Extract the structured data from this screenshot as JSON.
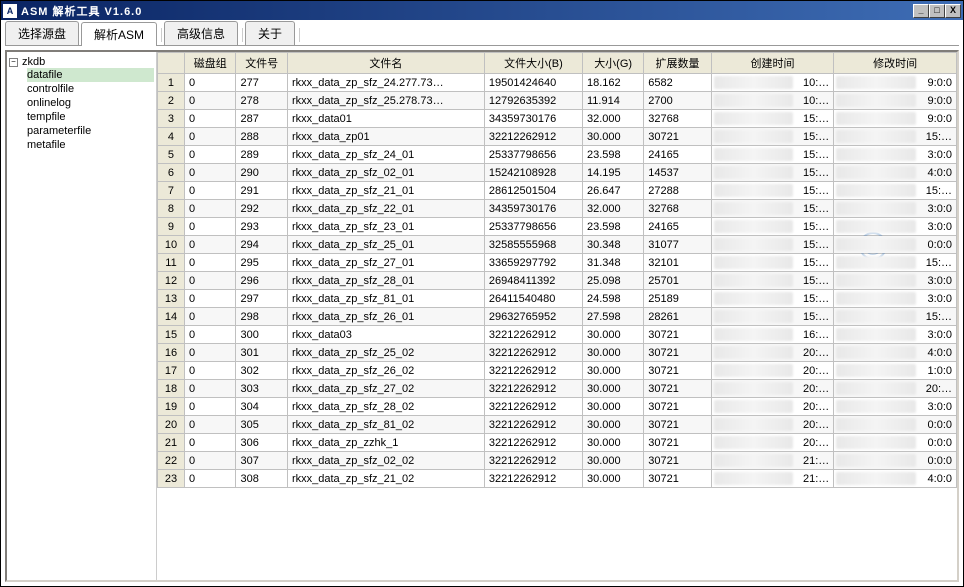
{
  "title": "ASM 解析工具  V1.6.0",
  "winbtns": {
    "min": "_",
    "max": "□",
    "close": "X"
  },
  "tabs": [
    "选择源盘",
    "解析ASM",
    "高级信息",
    "关于"
  ],
  "active_tab": 1,
  "tree": {
    "root": "zkdb",
    "children": [
      "datafile",
      "controlfile",
      "onlinelog",
      "tempfile",
      "parameterfile",
      "metafile"
    ],
    "selected_index": 0
  },
  "columns": {
    "disk": "磁盘组",
    "fileno": "文件号",
    "fname": "文件名",
    "fsize": "文件大小(B)",
    "gsize": "大小(G)",
    "ext": "扩展数量",
    "ctime": "创建时间",
    "mtime": "修改时间"
  },
  "rows": [
    {
      "n": 1,
      "disk": "0",
      "fileno": "277",
      "fname": "rkxx_data_zp_sfz_24.277.73…",
      "fsize": "19501424640",
      "gsize": "18.162",
      "ext": "6582",
      "ctime": "10:…",
      "mtime": "9:0:0"
    },
    {
      "n": 2,
      "disk": "0",
      "fileno": "278",
      "fname": "rkxx_data_zp_sfz_25.278.73…",
      "fsize": "12792635392",
      "gsize": "11.914",
      "ext": "2700",
      "ctime": "10:…",
      "mtime": "9:0:0"
    },
    {
      "n": 3,
      "disk": "0",
      "fileno": "287",
      "fname": "rkxx_data01",
      "fsize": "34359730176",
      "gsize": "32.000",
      "ext": "32768",
      "ctime": "15:…",
      "mtime": "9:0:0"
    },
    {
      "n": 4,
      "disk": "0",
      "fileno": "288",
      "fname": "rkxx_data_zp01",
      "fsize": "32212262912",
      "gsize": "30.000",
      "ext": "30721",
      "ctime": "15:…",
      "mtime": "15:…"
    },
    {
      "n": 5,
      "disk": "0",
      "fileno": "289",
      "fname": "rkxx_data_zp_sfz_24_01",
      "fsize": "25337798656",
      "gsize": "23.598",
      "ext": "24165",
      "ctime": "15:…",
      "mtime": "3:0:0"
    },
    {
      "n": 6,
      "disk": "0",
      "fileno": "290",
      "fname": "rkxx_data_zp_sfz_02_01",
      "fsize": "15242108928",
      "gsize": "14.195",
      "ext": "14537",
      "ctime": "15:…",
      "mtime": "4:0:0"
    },
    {
      "n": 7,
      "disk": "0",
      "fileno": "291",
      "fname": "rkxx_data_zp_sfz_21_01",
      "fsize": "28612501504",
      "gsize": "26.647",
      "ext": "27288",
      "ctime": "15:…",
      "mtime": "15:…"
    },
    {
      "n": 8,
      "disk": "0",
      "fileno": "292",
      "fname": "rkxx_data_zp_sfz_22_01",
      "fsize": "34359730176",
      "gsize": "32.000",
      "ext": "32768",
      "ctime": "15:…",
      "mtime": "3:0:0"
    },
    {
      "n": 9,
      "disk": "0",
      "fileno": "293",
      "fname": "rkxx_data_zp_sfz_23_01",
      "fsize": "25337798656",
      "gsize": "23.598",
      "ext": "24165",
      "ctime": "15:…",
      "mtime": "3:0:0"
    },
    {
      "n": 10,
      "disk": "0",
      "fileno": "294",
      "fname": "rkxx_data_zp_sfz_25_01",
      "fsize": "32585555968",
      "gsize": "30.348",
      "ext": "31077",
      "ctime": "15:…",
      "mtime": "0:0:0"
    },
    {
      "n": 11,
      "disk": "0",
      "fileno": "295",
      "fname": "rkxx_data_zp_sfz_27_01",
      "fsize": "33659297792",
      "gsize": "31.348",
      "ext": "32101",
      "ctime": "15:…",
      "mtime": "15:…"
    },
    {
      "n": 12,
      "disk": "0",
      "fileno": "296",
      "fname": "rkxx_data_zp_sfz_28_01",
      "fsize": "26948411392",
      "gsize": "25.098",
      "ext": "25701",
      "ctime": "15:…",
      "mtime": "3:0:0"
    },
    {
      "n": 13,
      "disk": "0",
      "fileno": "297",
      "fname": "rkxx_data_zp_sfz_81_01",
      "fsize": "26411540480",
      "gsize": "24.598",
      "ext": "25189",
      "ctime": "15:…",
      "mtime": "3:0:0"
    },
    {
      "n": 14,
      "disk": "0",
      "fileno": "298",
      "fname": "rkxx_data_zp_sfz_26_01",
      "fsize": "29632765952",
      "gsize": "27.598",
      "ext": "28261",
      "ctime": "15:…",
      "mtime": "15:…"
    },
    {
      "n": 15,
      "disk": "0",
      "fileno": "300",
      "fname": "rkxx_data03",
      "fsize": "32212262912",
      "gsize": "30.000",
      "ext": "30721",
      "ctime": "16:…",
      "mtime": "3:0:0"
    },
    {
      "n": 16,
      "disk": "0",
      "fileno": "301",
      "fname": "rkxx_data_zp_sfz_25_02",
      "fsize": "32212262912",
      "gsize": "30.000",
      "ext": "30721",
      "ctime": "20:…",
      "mtime": "4:0:0"
    },
    {
      "n": 17,
      "disk": "0",
      "fileno": "302",
      "fname": "rkxx_data_zp_sfz_26_02",
      "fsize": "32212262912",
      "gsize": "30.000",
      "ext": "30721",
      "ctime": "20:…",
      "mtime": "1:0:0"
    },
    {
      "n": 18,
      "disk": "0",
      "fileno": "303",
      "fname": "rkxx_data_zp_sfz_27_02",
      "fsize": "32212262912",
      "gsize": "30.000",
      "ext": "30721",
      "ctime": "20:…",
      "mtime": "20:…"
    },
    {
      "n": 19,
      "disk": "0",
      "fileno": "304",
      "fname": "rkxx_data_zp_sfz_28_02",
      "fsize": "32212262912",
      "gsize": "30.000",
      "ext": "30721",
      "ctime": "20:…",
      "mtime": "3:0:0"
    },
    {
      "n": 20,
      "disk": "0",
      "fileno": "305",
      "fname": "rkxx_data_zp_sfz_81_02",
      "fsize": "32212262912",
      "gsize": "30.000",
      "ext": "30721",
      "ctime": "20:…",
      "mtime": "0:0:0"
    },
    {
      "n": 21,
      "disk": "0",
      "fileno": "306",
      "fname": "rkxx_data_zp_zzhk_1",
      "fsize": "32212262912",
      "gsize": "30.000",
      "ext": "30721",
      "ctime": "20:…",
      "mtime": "0:0:0"
    },
    {
      "n": 22,
      "disk": "0",
      "fileno": "307",
      "fname": "rkxx_data_zp_sfz_02_02",
      "fsize": "32212262912",
      "gsize": "30.000",
      "ext": "30721",
      "ctime": "21:…",
      "mtime": "0:0:0"
    },
    {
      "n": 23,
      "disk": "0",
      "fileno": "308",
      "fname": "rkxx_data_zp_sfz_21_02",
      "fsize": "32212262912",
      "gsize": "30.000",
      "ext": "30721",
      "ctime": "21:…",
      "mtime": "4:0:0"
    }
  ]
}
